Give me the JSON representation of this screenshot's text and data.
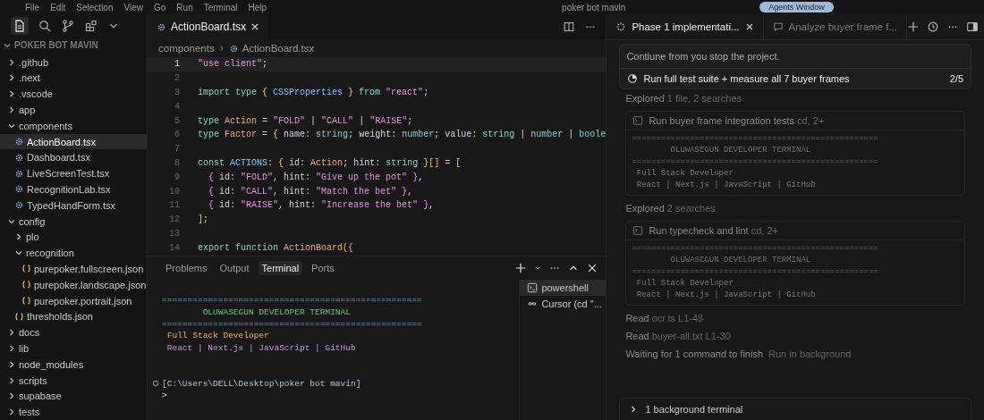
{
  "title_bar": {
    "menu": [
      "File",
      "Edit",
      "Selection",
      "View",
      "Go",
      "Run",
      "Terminal",
      "Help"
    ],
    "title": "poker bot mavin",
    "agents_button": "Agents Window"
  },
  "explorer": {
    "header": "POKER BOT MAVIN",
    "expanded": true,
    "tree": [
      {
        "label": ".github",
        "kind": "folder",
        "expanded": false,
        "selected": false
      },
      {
        "label": ".next",
        "kind": "folder",
        "expanded": false,
        "selected": false
      },
      {
        "label": ".vscode",
        "kind": "folder",
        "expanded": false,
        "selected": false
      },
      {
        "label": "app",
        "kind": "folder",
        "expanded": false,
        "selected": false
      },
      {
        "label": "components",
        "kind": "folder",
        "expanded": true,
        "selected": false,
        "children": [
          {
            "label": "ActionBoard.tsx",
            "kind": "tsx",
            "selected": true
          },
          {
            "label": "Dashboard.tsx",
            "kind": "tsx",
            "selected": false
          },
          {
            "label": "LiveScreenTest.tsx",
            "kind": "tsx",
            "selected": false
          },
          {
            "label": "RecognitionLab.tsx",
            "kind": "tsx",
            "selected": false
          },
          {
            "label": "TypedHandForm.tsx",
            "kind": "tsx",
            "selected": false
          }
        ]
      },
      {
        "label": "config",
        "kind": "folder",
        "expanded": true,
        "selected": false,
        "children": [
          {
            "label": "plo",
            "kind": "folder",
            "expanded": false,
            "selected": false
          },
          {
            "label": "recognition",
            "kind": "folder",
            "expanded": true,
            "selected": false,
            "children": [
              {
                "label": "purepoker.fullscreen.json",
                "kind": "json",
                "selected": false
              },
              {
                "label": "purepoker.landscape.json",
                "kind": "json",
                "selected": false
              },
              {
                "label": "purepoker.portrait.json",
                "kind": "json",
                "selected": false
              }
            ]
          },
          {
            "label": "thresholds.json",
            "kind": "json",
            "selected": false
          }
        ]
      },
      {
        "label": "docs",
        "kind": "folder",
        "expanded": false,
        "selected": false
      },
      {
        "label": "lib",
        "kind": "folder",
        "expanded": false,
        "selected": false
      },
      {
        "label": "node_modules",
        "kind": "folder",
        "expanded": false,
        "selected": false
      },
      {
        "label": "scripts",
        "kind": "folder",
        "expanded": false,
        "selected": false
      },
      {
        "label": "supabase",
        "kind": "folder",
        "expanded": false,
        "selected": false
      },
      {
        "label": "tests",
        "kind": "folder",
        "expanded": false,
        "selected": false
      }
    ]
  },
  "editor": {
    "tab": {
      "label": "ActionBoard.tsx",
      "selected": true
    },
    "breadcrumb": [
      "components",
      "ActionBoard.tsx"
    ],
    "lines": [
      {
        "number": "1",
        "selected": true,
        "tokens": [
          {
            "text": "\"use client\"",
            "kind": "str"
          },
          {
            "text": ";",
            "kind": "punc"
          }
        ]
      },
      {
        "number": "2",
        "selected": false
      },
      {
        "number": "3",
        "selected": false,
        "tokens": [
          {
            "text": "import type ",
            "kind": "kw"
          },
          {
            "text": "{",
            "kind": "brace"
          },
          {
            "text": " CSSProperties ",
            "kind": "ident"
          },
          {
            "text": "}",
            "kind": "brace"
          },
          {
            "text": " from ",
            "kind": "kw"
          },
          {
            "text": "\"react\"",
            "kind": "str"
          },
          {
            "text": ";",
            "kind": "punc"
          }
        ]
      },
      {
        "number": "4",
        "selected": false
      },
      {
        "number": "5",
        "selected": false,
        "tokens": [
          {
            "text": "type ",
            "kind": "kw"
          },
          {
            "text": "Action",
            "kind": "type"
          },
          {
            "text": " = ",
            "kind": "punc"
          },
          {
            "text": "\"FOLD\"",
            "kind": "str"
          },
          {
            "text": " | ",
            "kind": "punc"
          },
          {
            "text": "\"CALL\"",
            "kind": "str"
          },
          {
            "text": " | ",
            "kind": "punc"
          },
          {
            "text": "\"RAISE\"",
            "kind": "str"
          },
          {
            "text": ";",
            "kind": "punc"
          }
        ]
      },
      {
        "number": "6",
        "selected": false,
        "tokens": [
          {
            "text": "type ",
            "kind": "kw"
          },
          {
            "text": "Factor",
            "kind": "type"
          },
          {
            "text": " = ",
            "kind": "punc"
          },
          {
            "text": "{",
            "kind": "brace"
          },
          {
            "text": " name: ",
            "kind": "punc"
          },
          {
            "text": "string",
            "kind": "prim"
          },
          {
            "text": "; weight: ",
            "kind": "punc"
          },
          {
            "text": "number",
            "kind": "prim"
          },
          {
            "text": "; value: ",
            "kind": "punc"
          },
          {
            "text": "string",
            "kind": "prim"
          },
          {
            "text": " | ",
            "kind": "punc"
          },
          {
            "text": "number",
            "kind": "prim"
          },
          {
            "text": " | ",
            "kind": "punc"
          },
          {
            "text": "boole",
            "kind": "prim"
          }
        ]
      },
      {
        "number": "7",
        "selected": false
      },
      {
        "number": "8",
        "selected": false,
        "tokens": [
          {
            "text": "const ",
            "kind": "kw"
          },
          {
            "text": "ACTIONS",
            "kind": "ident"
          },
          {
            "text": ": ",
            "kind": "punc"
          },
          {
            "text": "{",
            "kind": "brace"
          },
          {
            "text": " id: ",
            "kind": "punc"
          },
          {
            "text": "Action",
            "kind": "type"
          },
          {
            "text": "; hint: ",
            "kind": "punc"
          },
          {
            "text": "string",
            "kind": "prim"
          },
          {
            "text": " }[]",
            "kind": "brace"
          },
          {
            "text": " = ",
            "kind": "punc"
          },
          {
            "text": "[",
            "kind": "brace"
          }
        ]
      },
      {
        "number": "9",
        "selected": false,
        "tokens": [
          {
            "text": "  {",
            "kind": "brace2"
          },
          {
            "text": " id: ",
            "kind": "punc"
          },
          {
            "text": "\"FOLD\"",
            "kind": "str"
          },
          {
            "text": ", hint: ",
            "kind": "punc"
          },
          {
            "text": "\"Give up the pot\"",
            "kind": "str"
          },
          {
            "text": " }",
            "kind": "brace2"
          },
          {
            "text": ",",
            "kind": "punc"
          }
        ]
      },
      {
        "number": "10",
        "selected": false,
        "tokens": [
          {
            "text": "  {",
            "kind": "brace2"
          },
          {
            "text": " id: ",
            "kind": "punc"
          },
          {
            "text": "\"CALL\"",
            "kind": "str"
          },
          {
            "text": ", hint: ",
            "kind": "punc"
          },
          {
            "text": "\"Match the bet\"",
            "kind": "str"
          },
          {
            "text": " }",
            "kind": "brace2"
          },
          {
            "text": ",",
            "kind": "punc"
          }
        ]
      },
      {
        "number": "11",
        "selected": false,
        "tokens": [
          {
            "text": "  {",
            "kind": "brace2"
          },
          {
            "text": " id: ",
            "kind": "punc"
          },
          {
            "text": "\"RAISE\"",
            "kind": "str"
          },
          {
            "text": ", hint: ",
            "kind": "punc"
          },
          {
            "text": "\"Increase the bet\"",
            "kind": "str"
          },
          {
            "text": " }",
            "kind": "brace2"
          },
          {
            "text": ",",
            "kind": "punc"
          }
        ]
      },
      {
        "number": "12",
        "selected": false,
        "tokens": [
          {
            "text": "]",
            "kind": "brace"
          },
          {
            "text": ";",
            "kind": "punc"
          }
        ]
      },
      {
        "number": "13",
        "selected": false
      },
      {
        "number": "14",
        "selected": false,
        "tokens": [
          {
            "text": "export function ",
            "kind": "kw"
          },
          {
            "text": "ActionBoard",
            "kind": "type"
          },
          {
            "text": "(",
            "kind": "brace"
          },
          {
            "text": "{",
            "kind": "brace2"
          }
        ]
      }
    ]
  },
  "panel": {
    "tabs": [
      {
        "label": "Problems",
        "selected": false
      },
      {
        "label": "Output",
        "selected": false
      },
      {
        "label": "Terminal",
        "selected": true
      },
      {
        "label": "Ports",
        "selected": false
      }
    ],
    "terminal_lines": [
      {
        "kind": "rule",
        "text": "==================================================="
      },
      {
        "kind": "title",
        "text": "        OLUWASEGUN DEVELOPER TERMINAL"
      },
      {
        "kind": "rule",
        "text": "==================================================="
      },
      {
        "kind": "role",
        "text": " Full Stack Developer"
      },
      {
        "kind": "stack",
        "text": " React | Next.js | JavaScript | GitHub"
      },
      {
        "kind": "blank"
      },
      {
        "kind": "blank"
      },
      {
        "kind": "prompt",
        "text": "[C:\\Users\\DELL\\Desktop\\poker bot mavin]"
      },
      {
        "kind": "cursor",
        "text": ">"
      }
    ],
    "terminals": [
      {
        "label": "powershell",
        "kind": "shell",
        "selected": true
      },
      {
        "label": "Cursor (cd \"...",
        "kind": "agent",
        "selected": false
      }
    ]
  },
  "agent": {
    "tabs": [
      {
        "label": "Phase 1 implementati...",
        "kind": "running",
        "selected": true
      },
      {
        "label": "Analyze buyer frame f...",
        "kind": "chat",
        "selected": false
      }
    ],
    "prompt": "Contiune from you stop the project.",
    "todo": {
      "label": "Run full test suite + measure all 7 buyer frames",
      "count": "2/5"
    },
    "steps": [
      {
        "kind": "note",
        "verb": "Explored",
        "detail": "1 file, 2 searches"
      },
      {
        "kind": "command",
        "verb": "Run buyer frame integration tests",
        "detail": "cd, 2+",
        "output": [
          {
            "kind": "rule",
            "text": "==================================================="
          },
          {
            "kind": "title",
            "text": "        OLUWASEGUN DEVELOPER TERMINAL"
          },
          {
            "kind": "rule",
            "text": "==================================================="
          },
          {
            "kind": "role",
            "text": " Full Stack Developer"
          },
          {
            "kind": "stack",
            "text": " React | Next.js | JavaScript | GitHub"
          }
        ]
      },
      {
        "kind": "note",
        "verb": "Explored",
        "detail": "2 searches"
      },
      {
        "kind": "command",
        "verb": "Run typecheck and lint",
        "detail": "cd, 2+",
        "output": [
          {
            "kind": "rule",
            "text": "==================================================="
          },
          {
            "kind": "title",
            "text": "        OLUWASEGUN DEVELOPER TERMINAL"
          },
          {
            "kind": "rule",
            "text": "==================================================="
          },
          {
            "kind": "role",
            "text": " Full Stack Developer"
          },
          {
            "kind": "stack",
            "text": " React | Next.js | JavaScript | GitHub"
          }
        ]
      },
      {
        "kind": "note",
        "verb": "Read",
        "detail": "ocr.ts L1-48"
      },
      {
        "kind": "note",
        "verb": "Read",
        "detail": "buyer-all.txt L1-30"
      },
      {
        "kind": "waiting",
        "verb": "Waiting for 1 command to finish",
        "detail": "Run in background"
      }
    ],
    "background": {
      "label": "1 background terminal",
      "expanded": false
    }
  }
}
